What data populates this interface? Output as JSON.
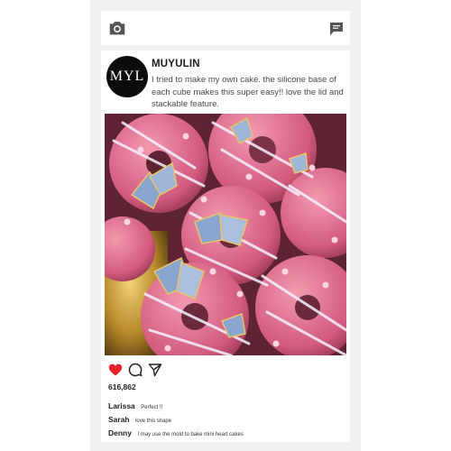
{
  "header": {
    "camera_icon": "camera-icon",
    "chat_icon": "chat-bubble-icon"
  },
  "post": {
    "avatar_text": "MYL",
    "username": "MUYULIN",
    "caption": "I tried to make my own cake. the silicone base of each cube makes this super easy!! love the lid and stackable feature.",
    "image_icon": "donut-photo",
    "liked": true,
    "like_color": "#e8202a",
    "like_count": "616,862",
    "comments": [
      {
        "user": "Larissa",
        "text": "Perfect !!"
      },
      {
        "user": "Sarah",
        "text": "love this shape"
      },
      {
        "user": "Denny",
        "text": "I may use the mold to bake mini heart cakes"
      }
    ]
  },
  "colors": {
    "background": "#f0f0f0",
    "card": "#ffffff",
    "icon_gray": "#555555"
  }
}
